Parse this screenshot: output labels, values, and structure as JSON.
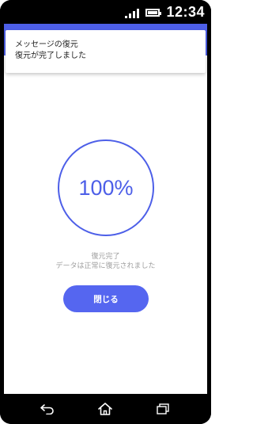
{
  "status_bar": {
    "time": "12:34",
    "signal_icon": "signal-icon",
    "battery_icon": "battery-icon"
  },
  "notification": {
    "title": "メッセージの復元",
    "body": "復元が完了しました"
  },
  "progress": {
    "value_label": "100%",
    "fraction": 1.0
  },
  "status": {
    "title": "復元完了",
    "detail": "データは正常に復元されました"
  },
  "actions": {
    "close_label": "閉じる"
  },
  "navigation": {
    "back_icon": "back-icon",
    "home_icon": "home-icon",
    "recents_icon": "recents-icon"
  },
  "colors": {
    "accent": "#4d5fe8",
    "button": "#5566f0",
    "muted_text": "#9e9e9e"
  }
}
